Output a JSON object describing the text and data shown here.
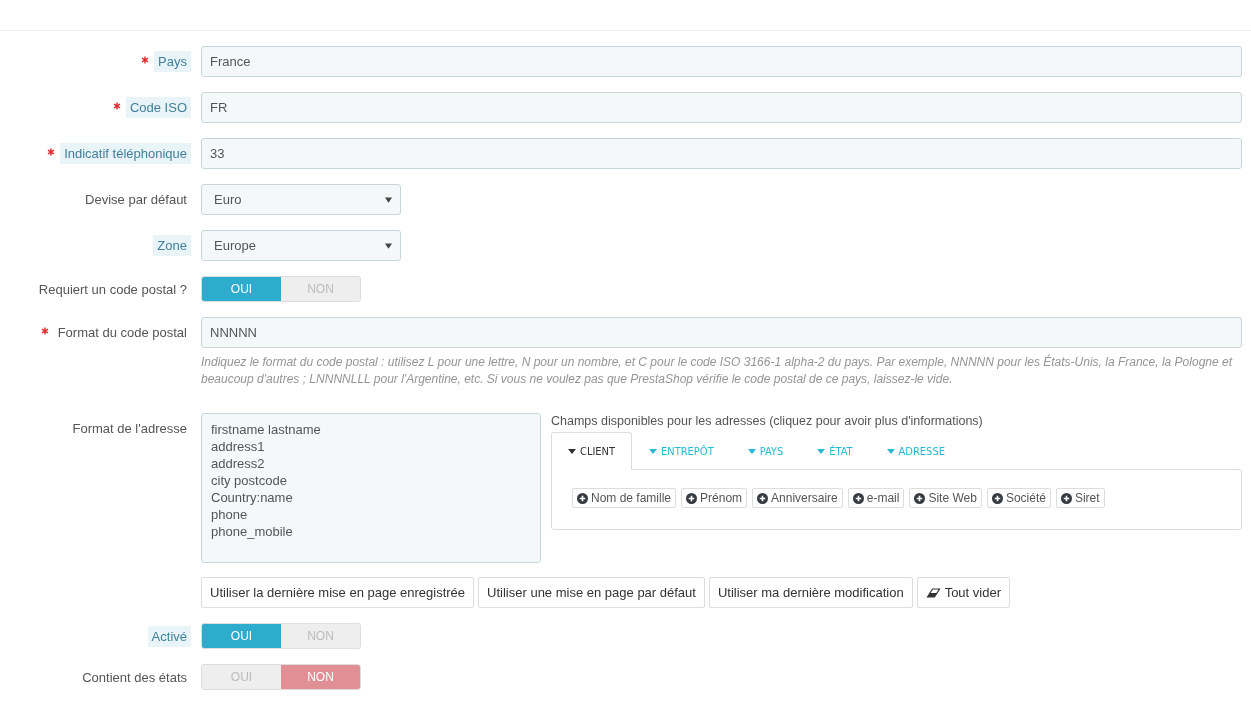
{
  "fields": [
    {
      "kind": "text",
      "label": "Pays",
      "required": true,
      "help": true,
      "value": "France"
    },
    {
      "kind": "text",
      "label": "Code ISO",
      "required": true,
      "help": true,
      "value": "FR"
    },
    {
      "kind": "text",
      "label": "Indicatif téléphonique",
      "required": true,
      "help": true,
      "value": "33"
    },
    {
      "kind": "select",
      "label": "Devise par défaut",
      "required": false,
      "help": false,
      "value": "Euro"
    },
    {
      "kind": "select",
      "label": "Zone",
      "required": false,
      "help": true,
      "value": "Europe"
    },
    {
      "kind": "switch",
      "label": "Requiert un code postal ?",
      "required": false,
      "help": false,
      "options": [
        {
          "label": "OUI",
          "selected": true
        },
        {
          "label": "NON",
          "selected": false
        }
      ]
    },
    {
      "kind": "text",
      "label": "Format du code postal",
      "required": true,
      "help": false,
      "value": "NNNNN",
      "hint": "Indiquez le format du code postal : utilisez L pour une lettre, N pour un nombre, et C pour le code ISO 3166-1 alpha-2 du pays. Par exemple, NNNNN pour les États-Unis, la France, la Pologne et beaucoup d'autres ; LNNNNLLL pour l'Argentine, etc. Si vous ne voulez pas que PrestaShop vérifie le code postal de ce pays, laissez-le vide."
    },
    {
      "kind": "address",
      "label": "Format de l'adresse",
      "required": false,
      "help": false,
      "lines": [
        "firstname lastname",
        "address1",
        "address2",
        "city postcode",
        "Country:name",
        "phone",
        "phone_mobile"
      ],
      "fields_title": "Champs disponibles pour les adresses (cliquez pour avoir plus d'informations)",
      "tabs": [
        {
          "label": "CLIENT",
          "selected": true
        },
        {
          "label": "ENTREPÔT",
          "selected": false
        },
        {
          "label": "PAYS",
          "selected": false
        },
        {
          "label": "ÉTAT",
          "selected": false
        },
        {
          "label": "ADRESSE",
          "selected": false
        }
      ],
      "chips": [
        "Nom de famille",
        "Prénom",
        "Anniversaire",
        "e-mail",
        "Site Web",
        "Société",
        "Siret"
      ],
      "buttons": [
        {
          "kind": "plain",
          "label": "Utiliser la dernière mise en page enregistrée"
        },
        {
          "kind": "plain",
          "label": "Utiliser une mise en page par défaut"
        },
        {
          "kind": "plain",
          "label": "Utiliser ma dernière modification"
        },
        {
          "kind": "eraser",
          "label": "Tout vider"
        }
      ]
    },
    {
      "kind": "switch",
      "label": "Activé",
      "required": false,
      "help": true,
      "options": [
        {
          "label": "OUI",
          "selected": true
        },
        {
          "label": "NON",
          "selected": false
        }
      ]
    },
    {
      "kind": "switch",
      "label": "Contient des états",
      "required": false,
      "help": false,
      "options": [
        {
          "label": "OUI",
          "selected": false
        },
        {
          "label": "NON",
          "selected": true
        }
      ]
    }
  ]
}
